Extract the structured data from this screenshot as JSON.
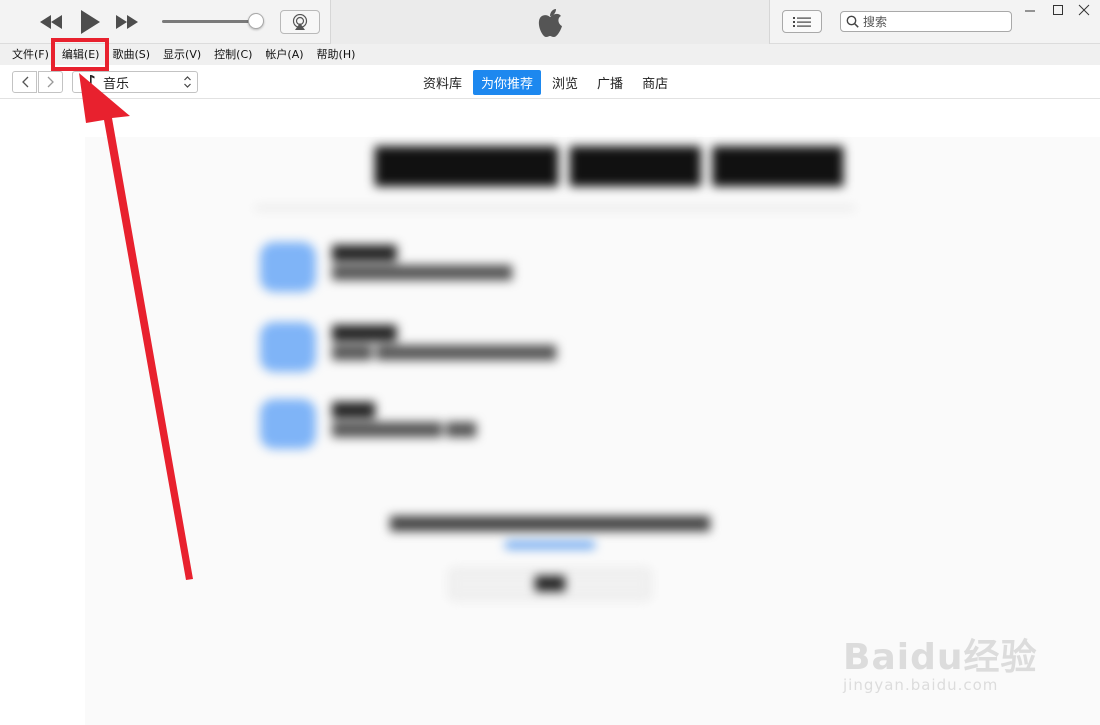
{
  "player": {
    "rewind_icon": "rewind-icon",
    "play_icon": "play-icon",
    "forward_icon": "fast-forward-icon",
    "volume_level": 0.9,
    "airplay_icon": "airplay-icon",
    "list_icon": "list-icon",
    "apple_logo": "apple-logo"
  },
  "search": {
    "placeholder": "搜索"
  },
  "window_controls": {
    "minimize_icon": "minimize-icon",
    "maximize_icon": "maximize-icon",
    "close_icon": "close-icon"
  },
  "menu": {
    "items": [
      "文件(F)",
      "编辑(E)",
      "歌曲(S)",
      "显示(V)",
      "控制(C)",
      "帐户(A)",
      "帮助(H)"
    ],
    "highlighted": "编辑(E)"
  },
  "nav": {
    "media_type": "音乐",
    "tabs": [
      "资料库",
      "为你推荐",
      "浏览",
      "广播",
      "商店"
    ],
    "active_tab": "为你推荐"
  },
  "colors": {
    "accent": "#1d88ef",
    "annotation_red": "#e8212e"
  },
  "watermark": {
    "logo": "Baidu经验",
    "url": "jingyan.baidu.com"
  }
}
